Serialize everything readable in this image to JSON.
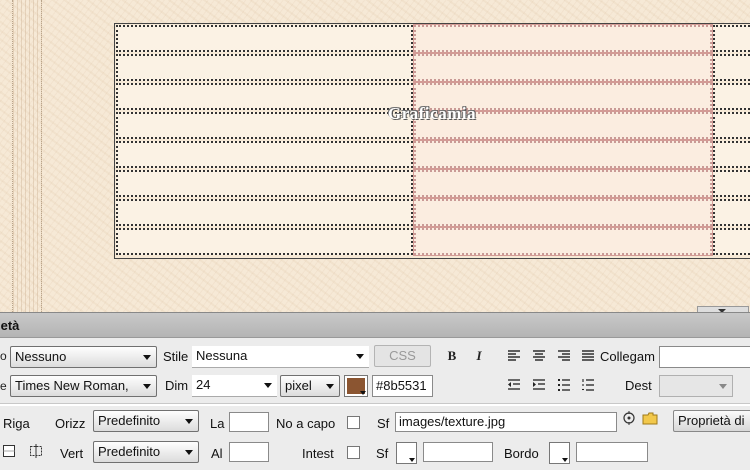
{
  "canvas": {
    "table_caption": "Graficamia",
    "rows": 8
  },
  "panel": {
    "title": "ietà",
    "row1": {
      "format_value": "Nessuno",
      "style_label": "Stile",
      "style_value": "Nessuna",
      "css_label": "CSS",
      "bold_label": "B",
      "italic_label": "I",
      "link_label": "Collegam",
      "link_value": ""
    },
    "row2": {
      "font_value": "Times New Roman,",
      "size_label": "Dim",
      "size_value": "24",
      "unit_value": "pixel",
      "text_color": "#8b5531",
      "text_color_value": "#8b5531",
      "target_label": "Dest",
      "target_value": ""
    },
    "row3": {
      "row_label": "Riga",
      "horz_label": "Orizz",
      "horz_value": "Predefinito",
      "width_label": "La",
      "width_value": "",
      "nowrap_label": "No a capo",
      "bg_label": "Sf",
      "bg_value": "images/texture.jpg",
      "page_props_label": "Proprietà di"
    },
    "row4": {
      "vert_label": "Vert",
      "vert_value": "Predefinito",
      "height_label": "Al",
      "height_value": "",
      "header_label": "Intest",
      "bg_color_label": "Sf",
      "bg_color_value": "",
      "border_label": "Bordo",
      "border_value": ""
    },
    "icons": {
      "align": [
        "align-left-icon",
        "align-center-icon",
        "align-right-icon",
        "align-justify-icon"
      ],
      "lists": [
        "outdent-icon",
        "indent-icon",
        "unordered-list-icon",
        "ordered-list-icon"
      ]
    }
  }
}
